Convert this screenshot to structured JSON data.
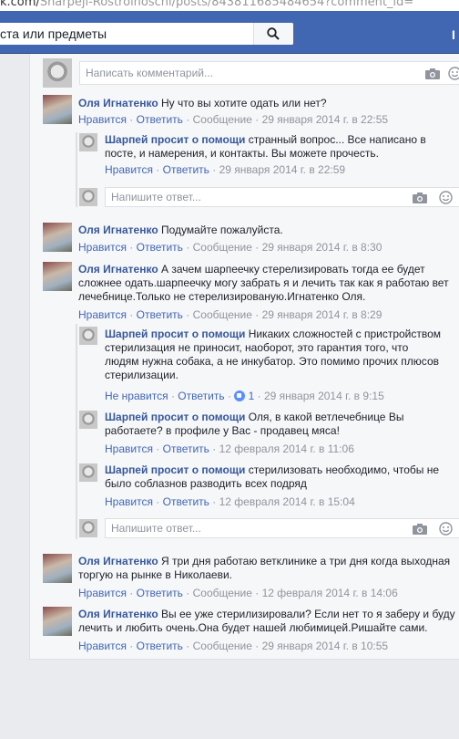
{
  "browser": {
    "url_prefix": "k.com/",
    "url_rest": "Sharpeji-Rostrolnoschi/posts/843811685484654?comment_id="
  },
  "search": {
    "value": "ста или предметы"
  },
  "edge_glyph": "I",
  "main_input": {
    "placeholder": "Написать комментарий..."
  },
  "reply_placeholder": "Напишите ответ...",
  "sep": "·",
  "comments": [
    {
      "author": "Оля Игнатенко",
      "text": "Ну что вы хотите одать или нет?",
      "like": "Нравится",
      "reply": "Ответить",
      "message": "Сообщение",
      "date": "29 января 2014 г. в 22:55"
    },
    {
      "author": "Шарпей просит о помощи",
      "text": "странный вопрос... Все написано в посте, и намерения, и контакты. Вы можете прочесть.",
      "like": "Нравится",
      "reply": "Ответить",
      "date": "29 января 2014 г. в 22:59"
    },
    {
      "author": "Оля Игнатенко",
      "text": "Подумайте пожалуйста.",
      "like": "Нравится",
      "reply": "Ответить",
      "message": "Сообщение",
      "date": "29 января 2014 г. в 8:30"
    },
    {
      "author": "Оля Игнатенко",
      "text": "А зачем шарпеечку стерелизировать тогда ее будет сложнее одать.шарпеечку могу забрать я и лечить так как я работаю вет лечебнице.Только не стерелизированую.Игнатенко Оля.",
      "like": "Нравится",
      "reply": "Ответить",
      "message": "Сообщение",
      "date": "29 января 2014 г. в 8:29"
    },
    {
      "author": "Шарпей просит о помощи",
      "text": "Никаких сложностей с пристройством стерилизация не приносит, наоборот, это гарантия того, что людям нужна собака, а не инкубатор. Это помимо прочих плюсов стерилизации.",
      "like": "Не нравится",
      "reply": "Ответить",
      "likes_count": "1",
      "date": "29 января 2014 г. в 9:15"
    },
    {
      "author": "Шарпей просит о помощи",
      "text": "Оля, в какой ветлечебнице Вы работаете? в профиле у Вас - продавец мяса!",
      "like": "Нравится",
      "reply": "Ответить",
      "date": "12 февраля 2014 г. в 11:06"
    },
    {
      "author": "Шарпей просит о помощи",
      "text": "стерилизовать необходимо, чтобы не было соблазнов разводить всех подряд",
      "like": "Нравится",
      "reply": "Ответить",
      "date": "12 февраля 2014 г. в 15:04"
    },
    {
      "author": "Оля Игнатенко",
      "text": "Я три дня работаю ветклинике а три дня когда выходная торгую на рынке в Николаеви.",
      "like": "Нравится",
      "reply": "Ответить",
      "message": "Сообщение",
      "date": "12 февраля 2014 г. в 14:06"
    },
    {
      "author": "Оля Игнатенко",
      "text": "Вы ее уже стерилизировали? Если нет то я заберу и буду лечить и любить очень.Она будет нашей любимицей.Ришайте сами.",
      "like": "Нравится",
      "reply": "Ответить",
      "message": "Сообщение",
      "date": "29 января 2014 г. в 10:55"
    }
  ]
}
